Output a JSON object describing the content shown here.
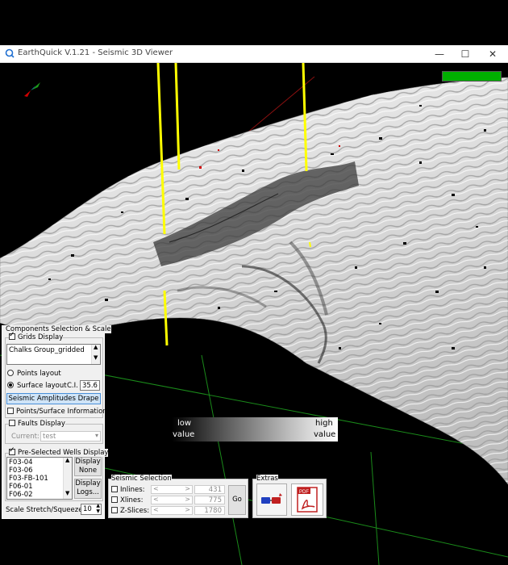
{
  "window": {
    "title": "EarthQuick V.1.21 - Seismic 3D Viewer",
    "minimize_symbol": "—",
    "maximize_symbol": "☐",
    "close_symbol": "✕"
  },
  "viewer": {
    "progress_fraction": 1.0,
    "progress_color": "#00b000",
    "well_color": "#ffff00",
    "icons": [
      "orientation-axes-icon",
      "seismic-3d-surface"
    ]
  },
  "legend": {
    "low_label": "low",
    "low_sub": "value",
    "high_label": "high",
    "high_sub": "value"
  },
  "panel": {
    "components_title": "Components Selection & Scale",
    "grids_display_label": "Grids Display",
    "grids_display_checked": true,
    "grid_selected": "Chalks Group_gridded",
    "points_layout_label": "Points layout",
    "surface_layout_label": "Surface layout",
    "layout_selected": "surface",
    "ci_label": "C.I.",
    "ci_value": "35.6",
    "seismic_drape_button": "Seismic Amplitudes Drape",
    "points_surface_info_label": "Points/Surface Information",
    "faults_display_label": "Faults Display",
    "faults_current_label": "Current:",
    "faults_current_value": "test",
    "wells_display_label": "Pre-Selected Wells Display",
    "wells": [
      "F03-04",
      "F03-06",
      "F03-FB-101",
      "F06-01",
      "F06-02"
    ],
    "display_none_button": "Display None",
    "display_logs_button": "Display Logs...",
    "scale_label": "Scale Stretch/Squeeze:",
    "scale_value": "10"
  },
  "seismic_selection": {
    "title": "Seismic Selection",
    "inlines_label": "Inlines:",
    "inlines_value": "431",
    "xlines_label": "Xlines:",
    "xlines_value": "775",
    "zslices_label": "Z-Slices:",
    "zslices_value": "1780",
    "go_button": "Go"
  },
  "extras": {
    "title": "Extras",
    "icons": [
      "screenshot-icon",
      "pdf-export-icon"
    ]
  }
}
